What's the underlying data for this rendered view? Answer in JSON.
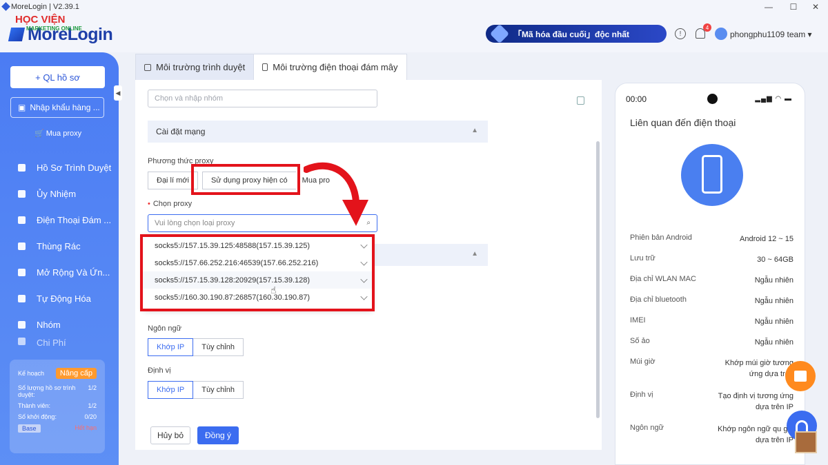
{
  "window": {
    "title": "MoreLogin | V2.39.1"
  },
  "brand": {
    "name": "MoreLogin",
    "watermark": "HỌC VIỆN",
    "watermark_sub": "MARKETING ONLINE"
  },
  "header": {
    "promo": "「Mã hóa đầu cuối」độc nhất",
    "notifications": "4",
    "user": "phongphu1109 team"
  },
  "sidebar": {
    "new_profile": "+ QL hồ sơ",
    "import": "Nhập khẩu hàng ...",
    "buy_proxy": "Mua proxy",
    "items": [
      {
        "label": "Hồ Sơ Trình Duyệt"
      },
      {
        "label": "Ủy Nhiệm"
      },
      {
        "label": "Điện Thoại Đám ..."
      },
      {
        "label": "Thùng Rác"
      },
      {
        "label": "Mở Rộng Và Ứn..."
      },
      {
        "label": "Tự Động Hóa"
      },
      {
        "label": "Nhóm"
      },
      {
        "label": "Chi Phí"
      }
    ],
    "plan": {
      "label": "Kế hoạch",
      "upgrade": "Nâng cấp",
      "rows": [
        {
          "k": "Số lượng hồ sơ trình duyệt:",
          "v": "1/2"
        },
        {
          "k": "Thành viên:",
          "v": "1/2"
        },
        {
          "k": "Số khởi động:",
          "v": "0/20"
        }
      ],
      "base": "Base",
      "expired": "Hết hạn"
    }
  },
  "tabs": [
    {
      "label": "Môi trường trình duyệt"
    },
    {
      "label": "Môi trường điện thoại đám mây"
    }
  ],
  "form": {
    "group_placeholder": "Chọn và nhập nhóm",
    "network_section": "Cài đặt mạng",
    "proxy_method_label": "Phương thức proxy",
    "proxy_methods": [
      "Đại lí mới",
      "Sử dụng proxy hiện có",
      "Mua pro"
    ],
    "choose_proxy_label": "Chọn proxy",
    "choose_proxy_placeholder": "Vui lòng chọn loại proxy",
    "proxies": [
      "socks5://157.15.39.125:48588(157.15.39.125)",
      "socks5://157.66.252.216:46539(157.66.252.216)",
      "socks5://157.15.39.128:20929(157.15.39.128)",
      "socks5://160.30.190.87:26857(160.30.190.87)"
    ],
    "language_label": "Ngôn ngữ",
    "language_options": [
      "Khớp IP",
      "Tùy chỉnh"
    ],
    "location_label": "Định vị",
    "location_options": [
      "Khớp IP",
      "Tùy chỉnh"
    ],
    "cancel": "Hủy bỏ",
    "ok": "Đồng ý"
  },
  "phone": {
    "time": "00:00",
    "title": "Liên quan đến điện thoại",
    "specs": [
      {
        "k": "Phiên bản Android",
        "v": "Android 12 ~ 15"
      },
      {
        "k": "Lưu trữ",
        "v": "30 ~ 64GB"
      },
      {
        "k": "Địa chỉ WLAN MAC",
        "v": "Ngẫu nhiên"
      },
      {
        "k": "Địa chỉ bluetooth",
        "v": "Ngẫu nhiên"
      },
      {
        "k": "IMEI",
        "v": "Ngẫu nhiên"
      },
      {
        "k": "Số ảo",
        "v": "Ngẫu nhiên"
      },
      {
        "k": "Múi giờ",
        "v": "Khớp múi giờ tương ứng dựa trên"
      },
      {
        "k": "Định vị",
        "v": "Tạo định vị tương ứng dựa trên IP"
      },
      {
        "k": "Ngôn ngữ",
        "v": "Khớp ngôn ngữ qu gia dựa trên IP"
      }
    ]
  },
  "colors": {
    "accent": "#3b6cf0",
    "highlight": "#e3131b",
    "sidebar": "#4b7cf3"
  }
}
